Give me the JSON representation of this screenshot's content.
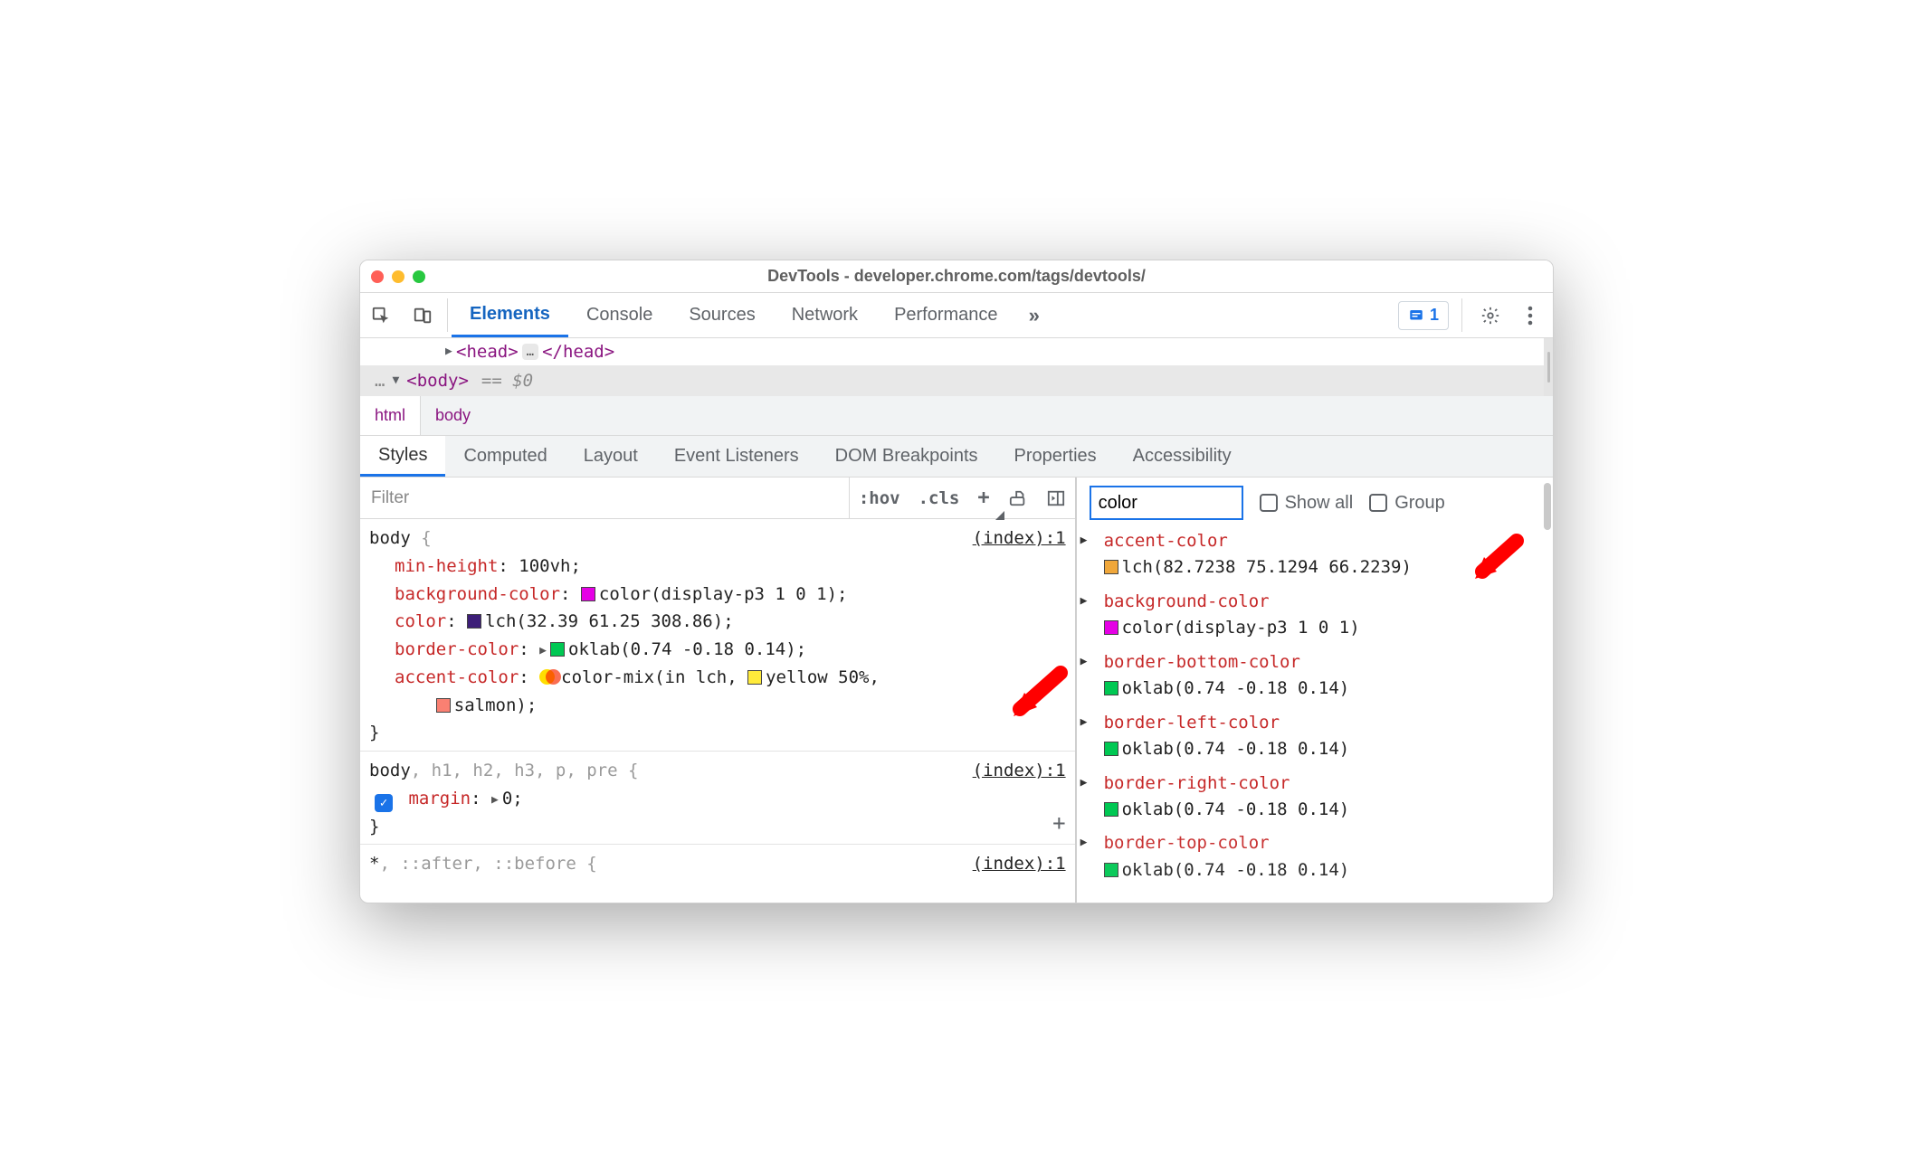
{
  "window": {
    "title": "DevTools - developer.chrome.com/tags/devtools/"
  },
  "toolbar": {
    "tabs": [
      "Elements",
      "Console",
      "Sources",
      "Network",
      "Performance"
    ],
    "overflow": "»",
    "active_tab": "Elements",
    "issues_count": "1"
  },
  "dom": {
    "head_open": "<head>",
    "head_close": "</head>",
    "ellipsis": "…",
    "body_open": "<body>",
    "body_marker": "== $0",
    "leading_dots": "…"
  },
  "breadcrumb": [
    "html",
    "body"
  ],
  "subtabs": [
    "Styles",
    "Computed",
    "Layout",
    "Event Listeners",
    "DOM Breakpoints",
    "Properties",
    "Accessibility"
  ],
  "styles": {
    "filter_placeholder": "Filter",
    "hov": ":hov",
    "cls": ".cls",
    "plus": "+",
    "rules": [
      {
        "selector_main": "body",
        "selector_dim": " {",
        "source": "(index):1",
        "declarations": [
          {
            "prop": "min-height",
            "value": "100vh"
          },
          {
            "prop": "background-color",
            "swatch": "#e500e5",
            "value": "color(display-p3 1 0 1)"
          },
          {
            "prop": "color",
            "swatch": "#3d1e78",
            "value": "lch(32.39 61.25 308.86)"
          },
          {
            "prop": "border-color",
            "tri": true,
            "swatch": "#00c853",
            "value": "oklab(0.74 -0.18 0.14)"
          },
          {
            "prop": "accent-color",
            "colormix": true,
            "value_pre": "color-mix(in lch, ",
            "y_swatch": "#ffeb3b",
            "value_mid": "yellow 50%,",
            "s_swatch": "#fa8072",
            "value_end": "salmon)"
          }
        ],
        "close": "}"
      },
      {
        "selector_main": "body",
        "selector_dim": ", h1, h2, h3, p, pre {",
        "source": "(index):1",
        "declarations": [
          {
            "checked": true,
            "prop": "margin",
            "tri": true,
            "value": "0"
          }
        ],
        "close": "}",
        "show_add_plus": true
      },
      {
        "selector_main": "*",
        "selector_dim": ", ::after, ::before {",
        "source": "(index):1",
        "declarations": [],
        "close": ""
      }
    ]
  },
  "computed": {
    "filter_value": "color",
    "show_all_label": "Show all",
    "group_label": "Group",
    "items": [
      {
        "prop": "accent-color",
        "swatch": "#f0a73a",
        "value": "lch(82.7238 75.1294 66.2239)"
      },
      {
        "prop": "background-color",
        "swatch": "#e500e5",
        "value": "color(display-p3 1 0 1)"
      },
      {
        "prop": "border-bottom-color",
        "swatch": "#00c853",
        "value": "oklab(0.74 -0.18 0.14)"
      },
      {
        "prop": "border-left-color",
        "swatch": "#00c853",
        "value": "oklab(0.74 -0.18 0.14)"
      },
      {
        "prop": "border-right-color",
        "swatch": "#00c853",
        "value": "oklab(0.74 -0.18 0.14)"
      },
      {
        "prop": "border-top-color",
        "swatch": "#00c853",
        "value": "oklab(0.74 -0.18 0.14)"
      }
    ]
  }
}
